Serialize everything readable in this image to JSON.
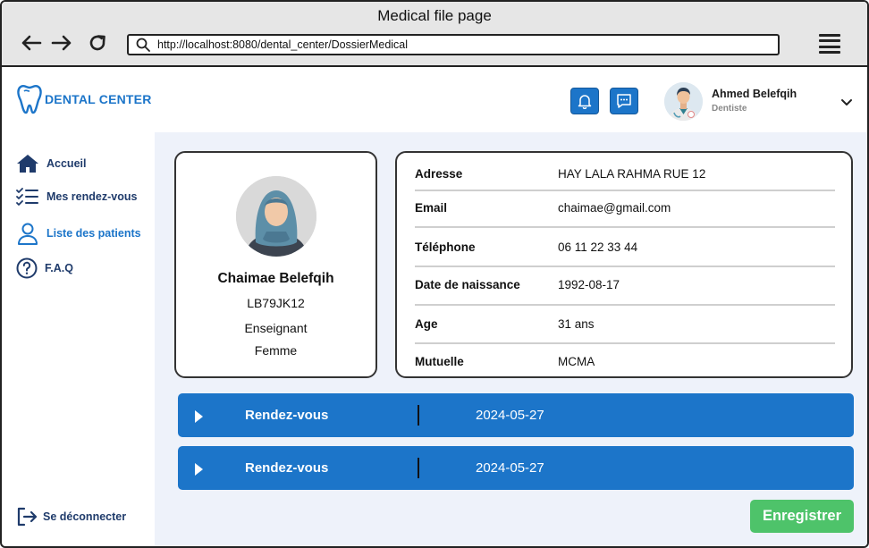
{
  "browser": {
    "window_title": "Medical file page",
    "url": "http://localhost:8080/dental_center/DossierMedical"
  },
  "app": {
    "logo_text": "DENTAL CENTER",
    "user": {
      "name": "Ahmed Belefqih",
      "role": "Dentiste"
    }
  },
  "sidebar": {
    "items": [
      {
        "label": "Accueil",
        "icon": "home-icon"
      },
      {
        "label": "Mes rendez-vous",
        "icon": "checklist-icon"
      },
      {
        "label": "Liste des patients",
        "icon": "user-icon",
        "active": true
      },
      {
        "label": "F.A.Q",
        "icon": "help-icon"
      }
    ],
    "logout_label": "Se déconnecter"
  },
  "patient": {
    "name": "Chaimae Belefqih",
    "id": "LB79JK12",
    "profession": "Enseignant",
    "gender": "Femme"
  },
  "details": [
    {
      "label": "Adresse",
      "value": "HAY LALA RAHMA RUE 12"
    },
    {
      "label": "Email",
      "value": "chaimae@gmail.com"
    },
    {
      "label": "Téléphone",
      "value": "06 11 22 33 44"
    },
    {
      "label": "Date de naissance",
      "value": "1992-08-17"
    },
    {
      "label": "Age",
      "value": "31 ans"
    },
    {
      "label": "Mutuelle",
      "value": "MCMA"
    }
  ],
  "appointments": [
    {
      "title": "Rendez-vous",
      "date": "2024-05-27"
    },
    {
      "title": "Rendez-vous",
      "date": "2024-05-27"
    }
  ],
  "save_label": "Enregistrer",
  "colors": {
    "primary": "#1c75c9",
    "success": "#4ec36a",
    "background": "#eef2fa"
  }
}
